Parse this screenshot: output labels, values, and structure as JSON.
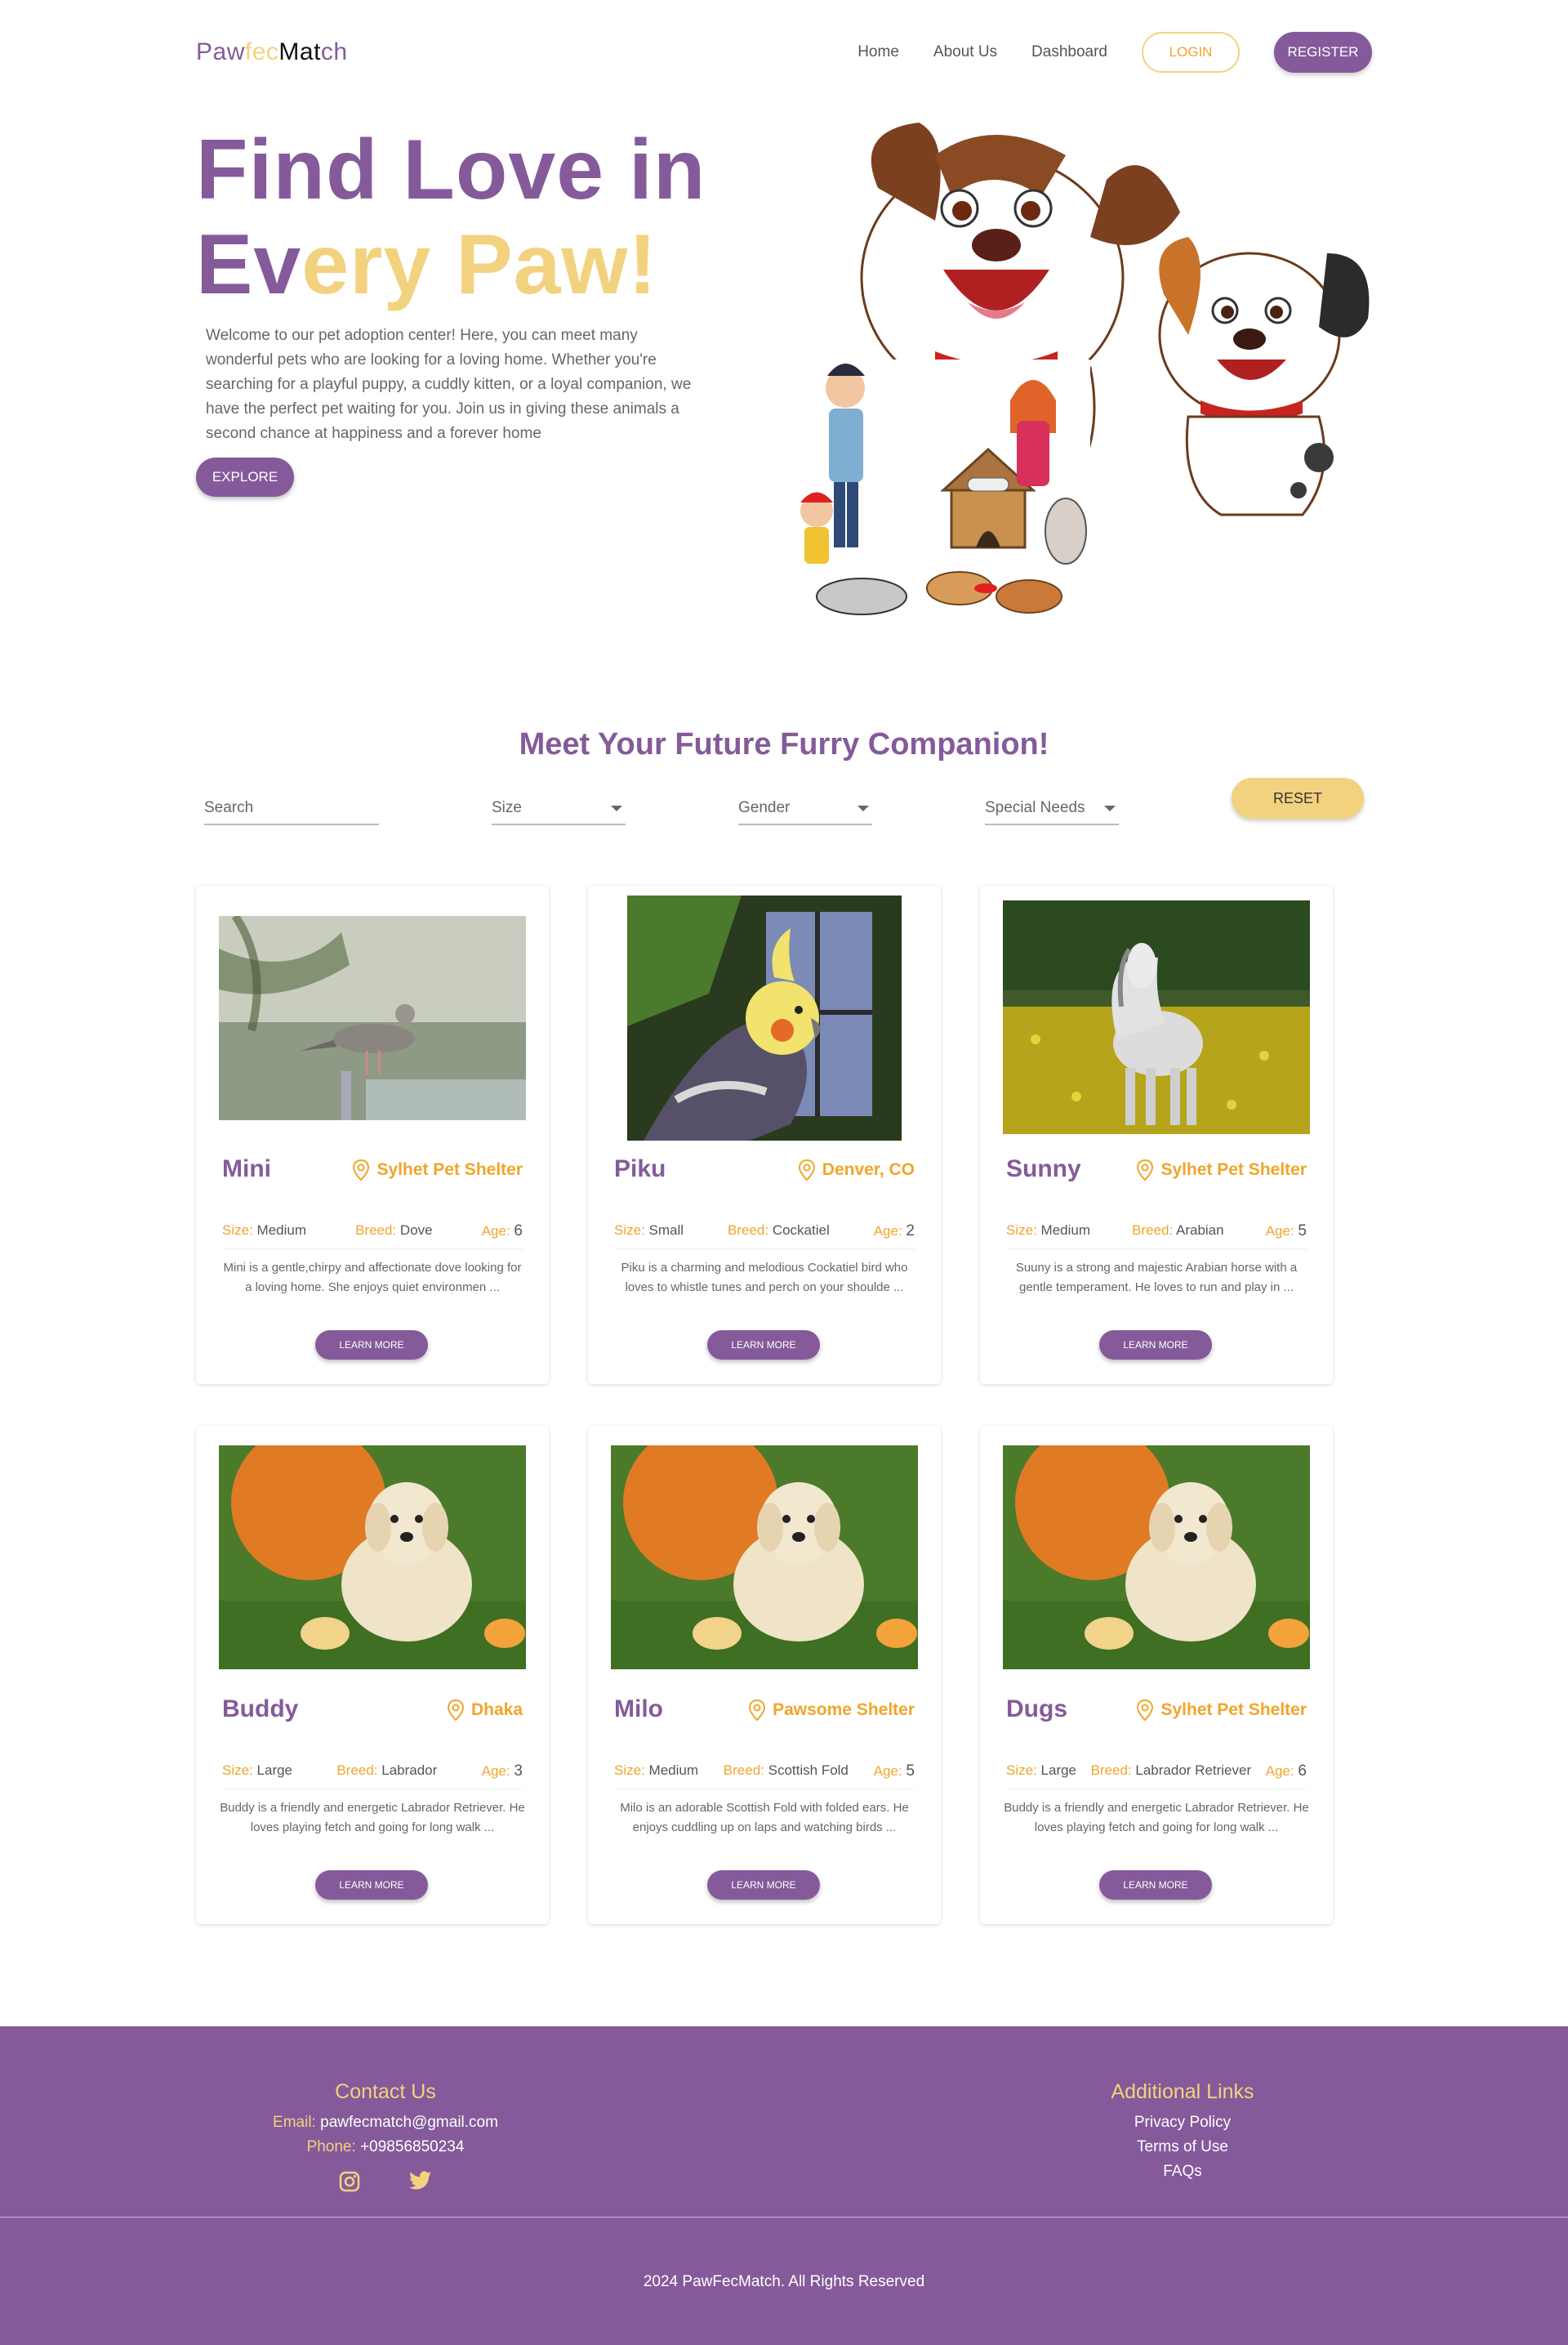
{
  "brand": {
    "part1": "Paw",
    "part2": "fec",
    "part3": "Mat",
    "part4": "ch"
  },
  "nav": {
    "home": "Home",
    "about": "About Us",
    "dashboard": "Dashboard",
    "login": "LOGIN",
    "register": "REGISTER"
  },
  "hero": {
    "line1": "Find Love in",
    "line2a": "Ev",
    "line2b": "ery Paw!",
    "description": "Welcome to our pet adoption center! Here, you can meet many wonderful pets who are looking for a loving home. Whether you're searching for a playful puppy, a cuddly kitten, or a loyal companion, we have the perfect pet waiting for you. Join us in giving these animals a second chance at happiness and a forever home",
    "explore": "EXPLORE"
  },
  "section": {
    "title": "Meet Your Future Furry Companion!"
  },
  "filters": {
    "search_placeholder": "Search",
    "size": "Size",
    "gender": "Gender",
    "special_needs": "Special Needs",
    "reset": "RESET"
  },
  "labels": {
    "size": "Size:",
    "breed": "Breed:",
    "age": "Age:",
    "learn_more": "LEARN MORE"
  },
  "pets": [
    {
      "name": "Mini",
      "location": "Sylhet Pet Shelter",
      "size": "Medium",
      "breed": "Dove",
      "age": "6",
      "description": "Mini is a gentle,chirpy and affectionate dove looking for a loving home. She enjoys quiet environmen ..."
    },
    {
      "name": "Piku",
      "location": "Denver, CO",
      "size": "Small",
      "breed": "Cockatiel",
      "age": "2",
      "description": "Piku is a charming and melodious Cockatiel bird who loves to whistle tunes and perch on your shoulde ..."
    },
    {
      "name": "Sunny",
      "location": "Sylhet Pet Shelter",
      "size": "Medium",
      "breed": "Arabian",
      "age": "5",
      "description": "Suuny is a strong and majestic Arabian horse with a gentle temperament. He loves to run and play in ..."
    },
    {
      "name": "Buddy",
      "location": "Dhaka",
      "size": "Large",
      "breed": "Labrador",
      "age": "3",
      "description": "Buddy is a friendly and energetic Labrador Retriever. He loves playing fetch and going for long walk ..."
    },
    {
      "name": "Milo",
      "location": "Pawsome Shelter",
      "size": "Medium",
      "breed": "Scottish Fold",
      "age": "5",
      "description": "Milo is an adorable Scottish Fold with folded ears. He enjoys cuddling up on laps and watching birds ..."
    },
    {
      "name": "Dugs",
      "location": "Sylhet Pet Shelter",
      "size": "Large",
      "breed": "Labrador Retriever",
      "age": "6",
      "description": "Buddy is a friendly and energetic Labrador Retriever. He loves playing fetch and going for long walk ..."
    }
  ],
  "footer": {
    "contact_heading": "Contact Us",
    "email_label": "Email:",
    "email": "pawfecmatch@gmail.com",
    "phone_label": "Phone:",
    "phone": "+09856850234",
    "links_heading": "Additional Links",
    "privacy": "Privacy Policy",
    "terms": "Terms of Use",
    "faqs": "FAQs",
    "copyright": "2024 PawFecMatch. All Rights Reserved"
  },
  "colors": {
    "primary": "#855A9A",
    "accent": "#F3D27F",
    "orange": "#F0A52B"
  },
  "icons": [
    "location-pin-icon",
    "instagram-icon",
    "twitter-icon",
    "dropdown-arrow-icon"
  ]
}
